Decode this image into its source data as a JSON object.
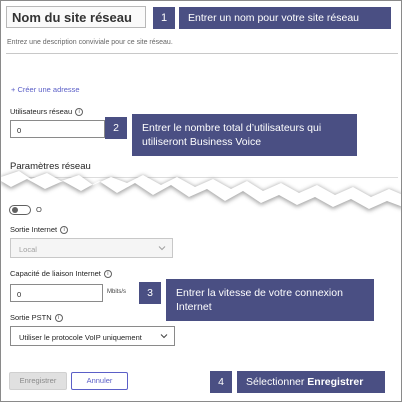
{
  "form": {
    "site_name_title": "Nom du site réseau",
    "description_placeholder": "Entrez une description conviviale pour ce site réseau.",
    "create_address_link": "+ Créer une adresse",
    "users_label": "Utilisateurs réseau",
    "users_value": "0",
    "section_title": "Paramètres réseau",
    "toggle_label": "O",
    "internet_egress_label": "Sortie Internet",
    "internet_egress_value": "Local",
    "link_capacity_label": "Capacité de liaison Internet",
    "link_capacity_value": "0",
    "link_capacity_units": "Mbits/s",
    "pstn_egress_label": "Sortie PSTN",
    "pstn_egress_value": "Utiliser le protocole VoIP uniquement",
    "save_label": "Enregistrer",
    "cancel_label": "Annuler",
    "info_glyph": "i"
  },
  "callouts": {
    "c1_num": "1",
    "c1_text": "Entrer un nom pour votre site réseau",
    "c2_num": "2",
    "c2_text": "Entrer le nombre total d’utilisateurs qui utiliseront Business Voice",
    "c3_num": "3",
    "c3_text": "Entrer la vitesse de votre connexion Internet",
    "c4_num": "4",
    "c4_text_prefix": "Sélectionner ",
    "c4_text_bold": "Enregistrer"
  },
  "colors": {
    "callout_bg": "#4a4f83",
    "link": "#5b5fc7"
  },
  "icons": [
    "info-icon",
    "chevron-down-icon"
  ]
}
